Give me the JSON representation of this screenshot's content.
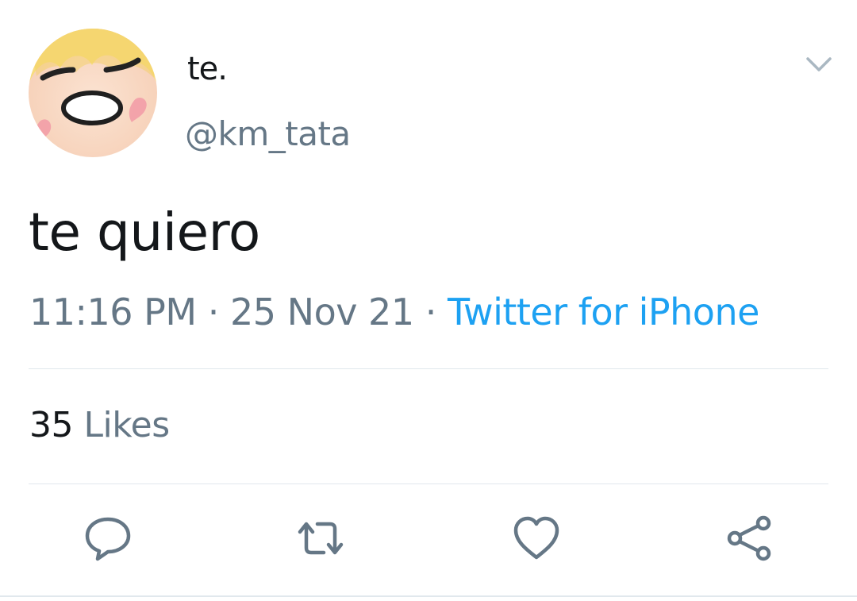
{
  "user": {
    "display_name": "te.",
    "handle": "@km_tata"
  },
  "tweet": {
    "text": "te quiero",
    "time": "11:16 PM",
    "date": "25 Nov 21",
    "separator": "·",
    "source": "Twitter for iPhone"
  },
  "stats": {
    "likes_count": "35",
    "likes_label": "Likes"
  },
  "icons": {
    "menu": "chevron-down-icon",
    "reply": "reply-icon",
    "retweet": "retweet-icon",
    "like": "heart-icon",
    "share": "share-icon"
  },
  "colors": {
    "text_primary": "#14171a",
    "text_secondary": "#657786",
    "link": "#1da1f2",
    "divider": "#e1e8ed"
  }
}
